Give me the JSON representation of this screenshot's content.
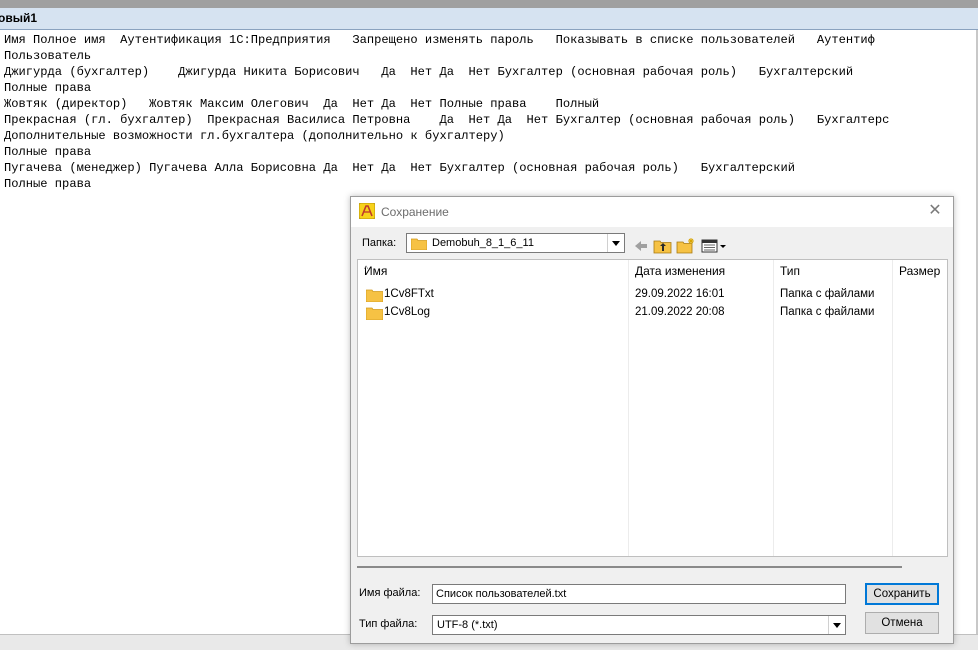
{
  "window": {
    "title": "овый1"
  },
  "document": {
    "lines": [
      "Имя Полное имя  Аутентификация 1С:Предприятия   Запрещено изменять пароль   Показывать в списке пользователей   Аутентиф",
      "Пользователь",
      "Джигурда (бухгалтер)    Джигурда Никита Борисович   Да  Нет Да  Нет Бухгалтер (основная рабочая роль)   Бухгалтерский",
      "Полные права",
      "Жовтяк (директор)   Жовтяк Максим Олегович  Да  Нет Да  Нет Полные права    Полный",
      "Прекрасная (гл. бухгалтер)  Прекрасная Василиса Петровна    Да  Нет Да  Нет Бухгалтер (основная рабочая роль)   Бухгалтерс",
      "Дополнительные возможности гл.бухгалтера (дополнительно к бухгалтеру)",
      "Полные права",
      "Пугачева (менеджер) Пугачева Алла Борисовна Да  Нет Да  Нет Бухгалтер (основная рабочая роль)   Бухгалтерский",
      "Полные права"
    ]
  },
  "dialog": {
    "title": "Сохранение",
    "folder_label": "Папка:",
    "folder_value": "Demobuh_8_1_6_11",
    "columns": [
      "Имя",
      "Дата изменения",
      "Тип",
      "Размер"
    ],
    "files": [
      {
        "name": "1Cv8FTxt",
        "date": "29.09.2022 16:01",
        "type": "Папка с файлами",
        "size": ""
      },
      {
        "name": "1Cv8Log",
        "date": "21.09.2022 20:08",
        "type": "Папка с файлами",
        "size": ""
      }
    ],
    "filename_label": "Имя файла:",
    "filename_value": "Список пользователей.txt",
    "filetype_label": "Тип файла:",
    "filetype_value": "UTF-8 (*.txt)",
    "save_button": "Сохранить",
    "cancel_button": "Отмена"
  }
}
